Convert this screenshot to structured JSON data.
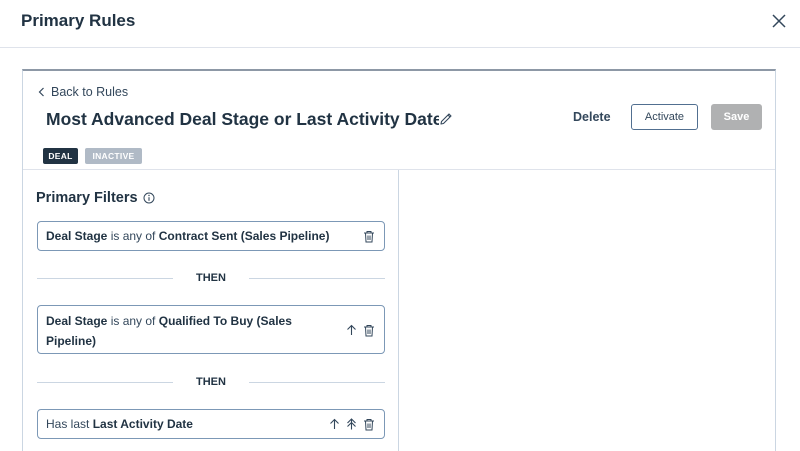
{
  "modal": {
    "title": "Primary Rules"
  },
  "rule": {
    "back_label": "Back to Rules",
    "title": "Most Advanced Deal Stage or Last Activity Date",
    "delete_label": "Delete",
    "activate_label": "Activate",
    "save_label": "Save",
    "object_badge": "DEAL",
    "status_badge": "INACTIVE"
  },
  "filters": {
    "heading": "Primary Filters",
    "then_label": "THEN",
    "items": [
      {
        "field": "Deal Stage",
        "operator": "is any of",
        "value": "Contract Sent (Sales Pipeline)"
      },
      {
        "field": "Deal Stage",
        "operator": "is any of",
        "value_line1": "Qualified To Buy (Sales",
        "value_line2": "Pipeline)"
      },
      {
        "prefix": "Has last",
        "field": "Last Activity Date"
      }
    ]
  },
  "colors": {
    "primary_text": "#213343",
    "badge_dark": "#213343",
    "badge_inactive": "#b0bac6",
    "save_disabled": "#b0b1b2",
    "filter_border": "#7c98b6"
  },
  "icons": [
    "close-icon",
    "chevron-left-icon",
    "pencil-icon",
    "info-icon",
    "trash-icon",
    "arrow-up-icon",
    "double-arrow-up-icon"
  ]
}
